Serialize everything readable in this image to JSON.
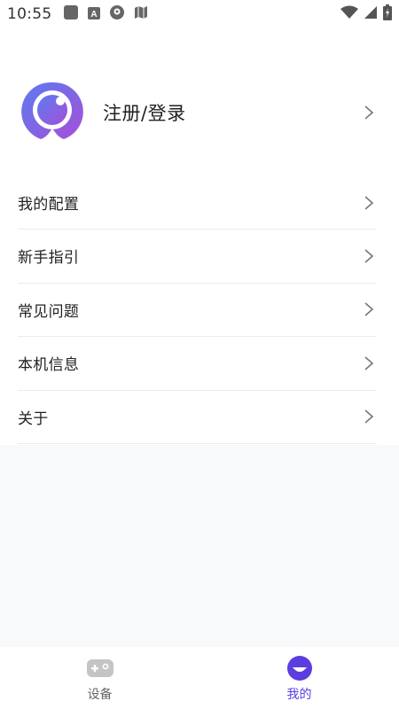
{
  "status_bar": {
    "time": "10:55",
    "left_icons": [
      "app-square-icon",
      "font-icon",
      "location-icon",
      "map-icon"
    ],
    "right_icons": [
      "wifi-icon",
      "signal-icon",
      "battery-icon"
    ]
  },
  "profile": {
    "label": "注册/登录",
    "avatar_icon": "app-logo-icon"
  },
  "menu": {
    "items": [
      {
        "label": "我的配置"
      },
      {
        "label": "新手指引"
      },
      {
        "label": "常见问题"
      },
      {
        "label": "本机信息"
      },
      {
        "label": "关于"
      }
    ]
  },
  "tab_bar": {
    "tabs": [
      {
        "label": "设备",
        "icon": "gamepad-icon",
        "active": false
      },
      {
        "label": "我的",
        "icon": "smile-icon",
        "active": true
      }
    ]
  },
  "colors": {
    "accent": "#5b3de0",
    "avatar_gradient_start": "#5a7cf0",
    "avatar_gradient_end": "#a64fd9",
    "page_background": "#f8f9fb",
    "divider": "#e5e5e5"
  }
}
